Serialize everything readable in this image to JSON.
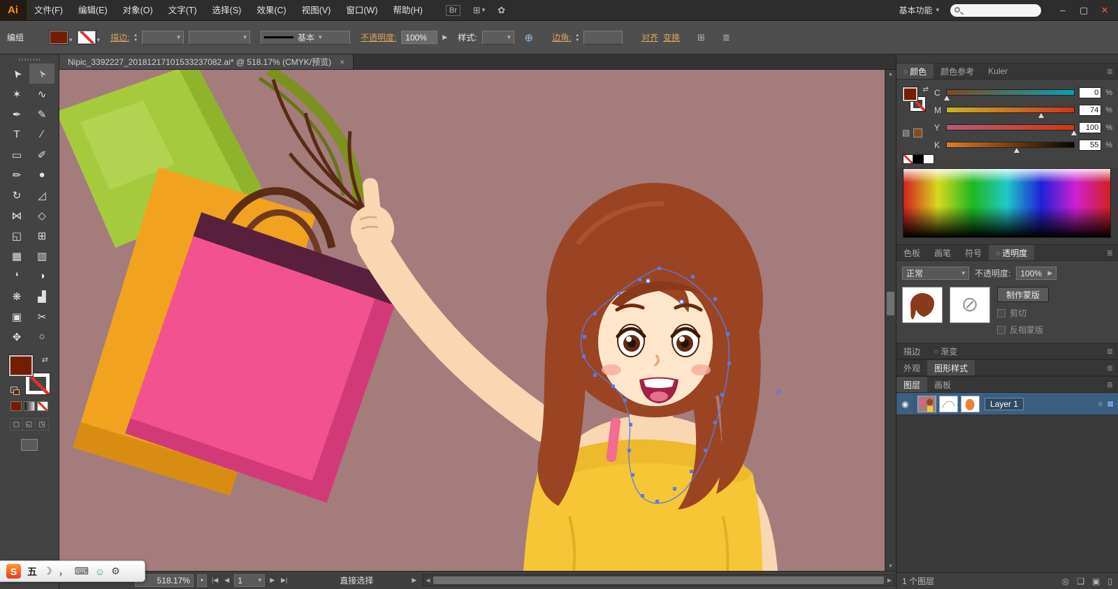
{
  "menubar": {
    "logo": "Ai",
    "items": [
      "文件(F)",
      "编辑(E)",
      "对象(O)",
      "文字(T)",
      "选择(S)",
      "效果(C)",
      "视图(V)",
      "窗口(W)",
      "帮助(H)"
    ],
    "workspace_label": "基本功能"
  },
  "icons": {
    "caret_down": "▾",
    "stepper_up": "▴",
    "stepper_down": "▾",
    "swap": "⇄",
    "menu": "≣",
    "panel_diamond": "◇",
    "eye": "◉",
    "target_circle": "○",
    "arrow_left": "◀",
    "arrow_right": "▶",
    "first": "|◀",
    "last": "▶|",
    "minimize": "–",
    "restore": "▢",
    "close": "✕",
    "bridge": "Br",
    "arrange": "⊞",
    "cs_live": "✿",
    "globe": "⊕",
    "cube": "▧",
    "scroll_up": "▲",
    "scroll_down": "▼",
    "no_sign": "⊘",
    "moon": "☽",
    "comma": "，",
    "keyboard": "⌨",
    "person": "☺",
    "wrench": "⚙",
    "locate": "◎",
    "sublayer": "❏",
    "new_layer": "▣",
    "trash": "▯",
    "flyout": "▶"
  },
  "controlbar": {
    "selection_label": "编组",
    "stroke_link": "描边:",
    "brush_value": "基本",
    "opacity_link": "不透明度:",
    "opacity_value": "100%",
    "style_label": "样式:",
    "corner_link": "边角:",
    "align_link": "对齐",
    "transform_link": "变换"
  },
  "document": {
    "tab_title": "Nipic_3392227_20181217101533237082.ai* @ 518.17% (CMYK/预览)",
    "close_glyph": "×"
  },
  "tools": [
    {
      "name": "selection-tool",
      "glyph": "➤"
    },
    {
      "name": "direct-selection-tool",
      "glyph": "➢"
    },
    {
      "name": "magic-wand-tool",
      "glyph": "✶"
    },
    {
      "name": "lasso-tool",
      "glyph": "∿"
    },
    {
      "name": "pen-tool",
      "glyph": "✒"
    },
    {
      "name": "anchor-point-tool",
      "glyph": "✎"
    },
    {
      "name": "type-tool",
      "glyph": "T"
    },
    {
      "name": "line-segment-tool",
      "glyph": "∕"
    },
    {
      "name": "rectangle-tool",
      "glyph": "▭"
    },
    {
      "name": "paintbrush-tool",
      "glyph": "✐"
    },
    {
      "name": "pencil-tool",
      "glyph": "✏"
    },
    {
      "name": "blob-brush-tool",
      "glyph": "●"
    },
    {
      "name": "rotate-tool",
      "glyph": "↻"
    },
    {
      "name": "scale-tool",
      "glyph": "◿"
    },
    {
      "name": "width-tool",
      "glyph": "⋈"
    },
    {
      "name": "free-transform-tool",
      "glyph": "◇"
    },
    {
      "name": "shape-builder-tool",
      "glyph": "◱"
    },
    {
      "name": "perspective-grid-tool",
      "glyph": "⊞"
    },
    {
      "name": "mesh-tool",
      "glyph": "▦"
    },
    {
      "name": "gradient-tool",
      "glyph": "▥"
    },
    {
      "name": "eyedropper-tool",
      "glyph": "❛"
    },
    {
      "name": "blend-tool",
      "glyph": "◑"
    },
    {
      "name": "symbol-sprayer-tool",
      "glyph": "❋"
    },
    {
      "name": "column-graph-tool",
      "glyph": "▟"
    },
    {
      "name": "artboard-tool",
      "glyph": "▣"
    },
    {
      "name": "slice-tool",
      "glyph": "✂"
    },
    {
      "name": "hand-tool",
      "glyph": "✥"
    },
    {
      "name": "zoom-tool",
      "glyph": "○"
    }
  ],
  "color_panel": {
    "tabs": [
      "颜色",
      "颜色参考",
      "Kuler"
    ],
    "percent": "%",
    "channels": [
      {
        "label": "C",
        "value": "0"
      },
      {
        "label": "M",
        "value": "74"
      },
      {
        "label": "Y",
        "value": "100"
      },
      {
        "label": "K",
        "value": "55"
      }
    ]
  },
  "swatch_tabs": [
    "色板",
    "画笔",
    "符号",
    "透明度"
  ],
  "transparency": {
    "blend_mode": "正常",
    "opacity_label": "不透明度:",
    "opacity_value": "100%",
    "make_mask_button": "制作蒙版",
    "clip_label": "剪切",
    "invert_label": "反相蒙版"
  },
  "collapsed_tabs": {
    "stroke": "描边",
    "gradient": "渐变",
    "appearance": "外观",
    "graphic_styles": "图形样式"
  },
  "layers_panel": {
    "tabs": [
      "图层",
      "画板"
    ],
    "layer_name": "Layer 1",
    "count_text": "1 个图层"
  },
  "statusbar": {
    "zoom_value": "518.17%",
    "artboard_value": "1",
    "tool_name": "直接选择"
  },
  "ime": {
    "s_logo": "S",
    "mode": "五"
  },
  "colors": {
    "canvas_background": "#a57c7c",
    "current_fill": "#731e00",
    "selection_accent": "#5b7be0"
  }
}
